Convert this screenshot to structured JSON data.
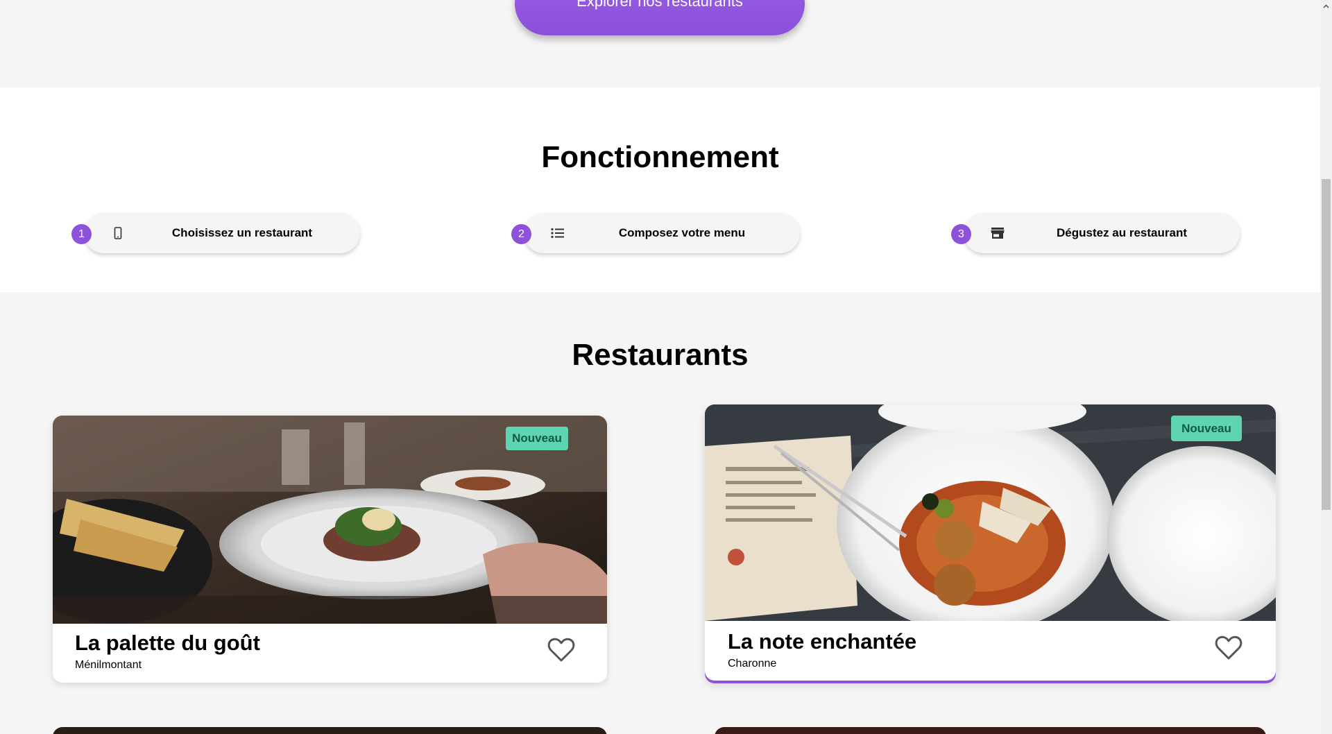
{
  "hero": {
    "explore_label": "Explorer nos restaurants"
  },
  "how_it_works": {
    "title": "Fonctionnement",
    "steps": [
      {
        "number": "1",
        "icon": "smartphone-icon",
        "label": "Choisissez un restaurant"
      },
      {
        "number": "2",
        "icon": "list-icon",
        "label": "Composez votre menu"
      },
      {
        "number": "3",
        "icon": "store-icon",
        "label": "Dégustez au restaurant"
      }
    ]
  },
  "restaurants": {
    "title": "Restaurants",
    "cards": [
      {
        "name": "La palette du goût",
        "location": "Ménilmontant",
        "badge": "Nouveau",
        "favorite_icon": "heart-outline-icon"
      },
      {
        "name": "La note enchantée",
        "location": "Charonne",
        "badge": "Nouveau",
        "favorite_icon": "heart-outline-icon"
      }
    ]
  },
  "colors": {
    "accent": "#8c52d9",
    "badge_bg": "#5fd4b0",
    "badge_text": "#0d5a45"
  }
}
